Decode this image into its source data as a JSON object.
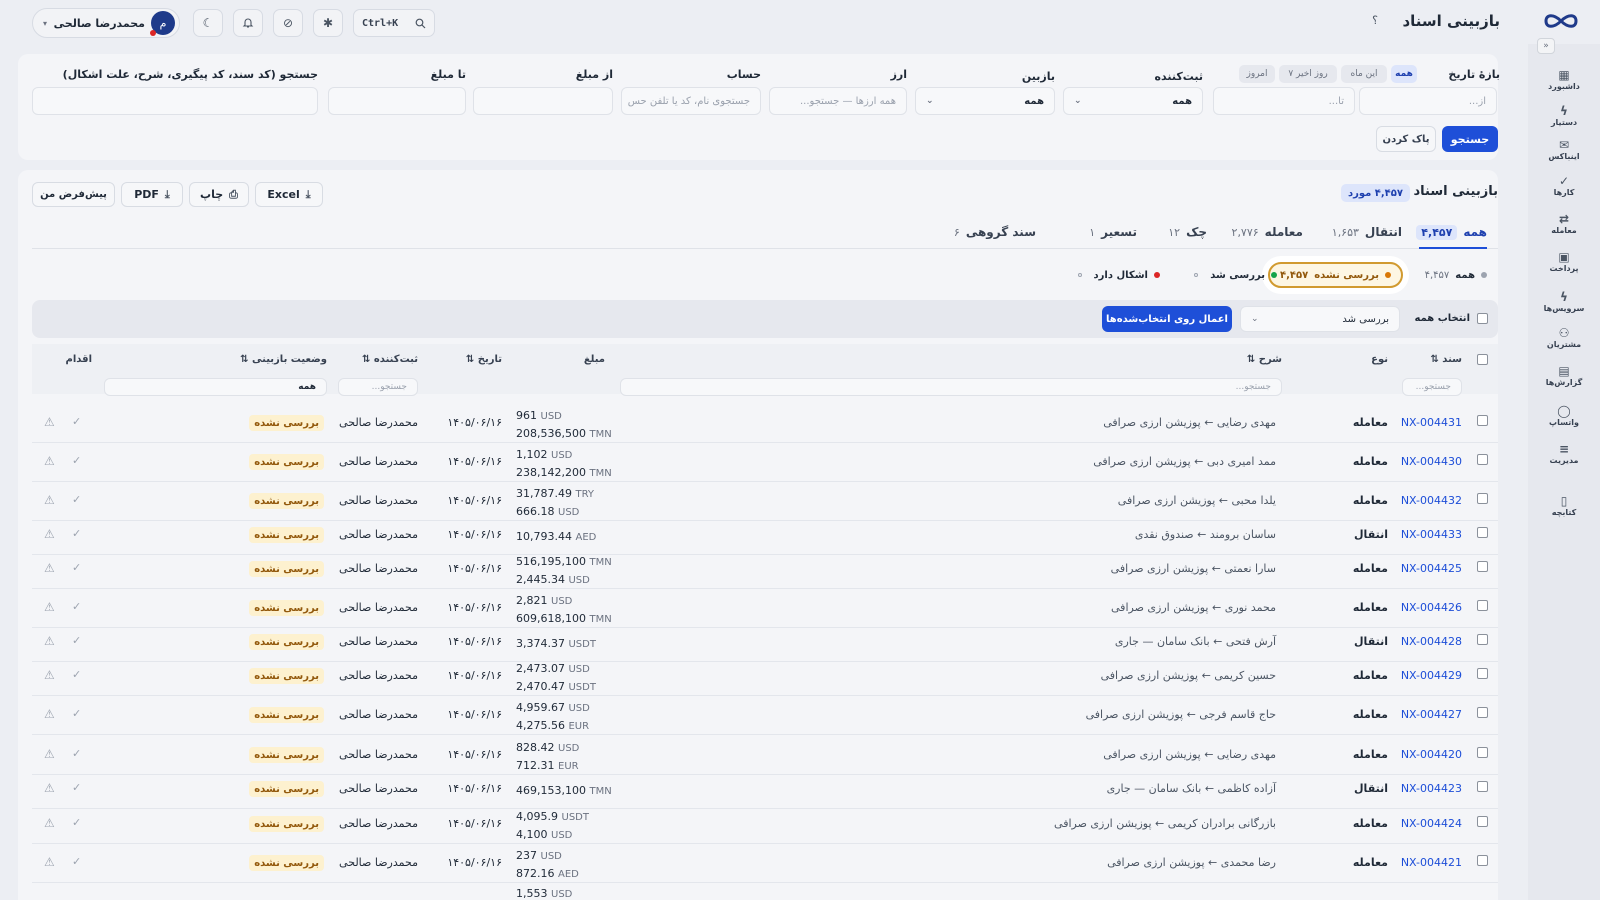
{
  "page_title": "بازبینی اسناد",
  "user": {
    "name": "محمدرضا صالحی",
    "avatar_initial": "م"
  },
  "search_shortcut": "Ctrl+K",
  "sidebar_items": [
    {
      "label": "داشبورد",
      "icon": "dashboard-icon",
      "glyph": "▦"
    },
    {
      "label": "دستیار",
      "icon": "bolt-icon",
      "glyph": "ϟ"
    },
    {
      "label": "اینباکس",
      "icon": "inbox-icon",
      "glyph": "✉"
    },
    {
      "label": "کارها",
      "icon": "check-icon",
      "glyph": "✓"
    },
    {
      "label": "معامله",
      "icon": "exchange-icon",
      "glyph": "⇄"
    },
    {
      "label": "پرداخت",
      "icon": "wallet-icon",
      "glyph": "▣"
    },
    {
      "label": "سرویس‌ها",
      "icon": "bolt-icon",
      "glyph": "ϟ"
    },
    {
      "label": "مشتریان",
      "icon": "users-icon",
      "glyph": "⚇"
    },
    {
      "label": "گزارش‌ها",
      "icon": "report-icon",
      "glyph": "▤"
    },
    {
      "label": "واتساپ",
      "icon": "chat-icon",
      "glyph": "◯"
    },
    {
      "label": "مدیریت",
      "icon": "sliders-icon",
      "glyph": "≡"
    },
    {
      "label": "کتابچه",
      "icon": "book-icon",
      "glyph": "▯"
    }
  ],
  "filters": {
    "date_range_label": "بازهٔ تاریخ",
    "quick_ranges": [
      "همه",
      "این ماه",
      "۷ روز اخیر",
      "امروز"
    ],
    "from_placeholder": "از...",
    "to_placeholder": "تا...",
    "registrar_label": "ثبت‌کننده",
    "registrar_value": "همه",
    "reviewer_label": "بازبین",
    "reviewer_value": "همه",
    "currency_label": "ارز",
    "currency_placeholder": "همه ارزها — جستجو...",
    "account_label": "حساب",
    "account_placeholder": "جستجوی نام، کد یا تلفن حس",
    "amount_from_label": "از مبلغ",
    "amount_to_label": "تا مبلغ",
    "search_label": "جستجو (کد سند، کد پیگیری، شرح، علت اشکال)",
    "search_button": "جستجو",
    "clear_button": "پاک کردن"
  },
  "list": {
    "title": "بازبینی اسناد",
    "count_badge": "۴,۴۵۷ مورد",
    "toolbar": {
      "excel": "Excel",
      "print": "چاپ",
      "pdf": "PDF",
      "default": "پیش‌فرض من"
    },
    "tabs": [
      {
        "label": "همه",
        "count": "۴,۴۵۷"
      },
      {
        "label": "انتقال",
        "count": "۱,۶۵۳"
      },
      {
        "label": "معامله",
        "count": "۲,۷۷۶"
      },
      {
        "label": "چک",
        "count": "۱۲"
      },
      {
        "label": "تسعیر",
        "count": "۱"
      },
      {
        "label": "سند گروهی",
        "count": "۶"
      }
    ],
    "status_filters": [
      {
        "label": "همه",
        "count": "۴,۴۵۷",
        "color": "#9ca3af"
      },
      {
        "label": "بررسی نشده",
        "count": "۴,۴۵۷",
        "color": "#d97706"
      },
      {
        "label": "بررسی شد",
        "count": "",
        "color": "#16a34a"
      },
      {
        "label": "اشکال دارد",
        "count": "",
        "color": "#dc2626"
      }
    ],
    "select_all": "انتخاب همه",
    "bulk_action_value": "بررسی شد",
    "apply_button": "اعمال روی انتخاب‌شده‌ها",
    "columns": {
      "doc": "سند ⇅",
      "type": "نوع",
      "desc": "شرح ⇅",
      "amount": "مبلغ",
      "date": "تاریخ ⇅",
      "registrar": "ثبت‌کننده ⇅",
      "status": "وضعیت بازبینی ⇅",
      "action": "اقدام"
    },
    "column_filters": {
      "doc": "جستجو...",
      "desc": "جستجو...",
      "registrar": "جستجو...",
      "status": "همه"
    }
  },
  "rows": [
    {
      "code": "NX-004431",
      "type": "معامله",
      "desc": "مهدی رضایی ← پوزیشن ارزی صرافی",
      "amounts": [
        {
          "v": "961",
          "c": "USD"
        },
        {
          "v": "208,536,500",
          "c": "TMN"
        }
      ],
      "date": "۱۴۰۵/۰۶/۱۶",
      "registrar": "محمدرضا صالحی",
      "status": "بررسی نشده"
    },
    {
      "code": "NX-004430",
      "type": "معامله",
      "desc": "ممد امیری دبی ← پوزیشن ارزی صرافی",
      "amounts": [
        {
          "v": "1,102",
          "c": "USD"
        },
        {
          "v": "238,142,200",
          "c": "TMN"
        }
      ],
      "date": "۱۴۰۵/۰۶/۱۶",
      "registrar": "محمدرضا صالحی",
      "status": "بررسی نشده"
    },
    {
      "code": "NX-004432",
      "type": "معامله",
      "desc": "یلدا محبی ← پوزیشن ارزی صرافی",
      "amounts": [
        {
          "v": "31,787.49",
          "c": "TRY"
        },
        {
          "v": "666.18",
          "c": "USD"
        }
      ],
      "date": "۱۴۰۵/۰۶/۱۶",
      "registrar": "محمدرضا صالحی",
      "status": "بررسی نشده"
    },
    {
      "code": "NX-004433",
      "type": "انتقال",
      "desc": "ساسان برومند ← صندوق نقدی",
      "amounts": [
        {
          "v": "10,793.44",
          "c": "AED"
        }
      ],
      "date": "۱۴۰۵/۰۶/۱۶",
      "registrar": "محمدرضا صالحی",
      "status": "بررسی نشده"
    },
    {
      "code": "NX-004425",
      "type": "معامله",
      "desc": "سارا نعمتی ← پوزیشن ارزی صرافی",
      "amounts": [
        {
          "v": "516,195,100",
          "c": "TMN"
        },
        {
          "v": "2,445.34",
          "c": "USD"
        }
      ],
      "date": "۱۴۰۵/۰۶/۱۶",
      "registrar": "محمدرضا صالحی",
      "status": "بررسی نشده"
    },
    {
      "code": "NX-004426",
      "type": "معامله",
      "desc": "محمد نوری ← پوزیشن ارزی صرافی",
      "amounts": [
        {
          "v": "2,821",
          "c": "USD"
        },
        {
          "v": "609,618,100",
          "c": "TMN"
        }
      ],
      "date": "۱۴۰۵/۰۶/۱۶",
      "registrar": "محمدرضا صالحی",
      "status": "بررسی نشده"
    },
    {
      "code": "NX-004428",
      "type": "انتقال",
      "desc": "آرش فتحی ← بانک سامان — جاری",
      "amounts": [
        {
          "v": "3,374.37",
          "c": "USDT"
        }
      ],
      "date": "۱۴۰۵/۰۶/۱۶",
      "registrar": "محمدرضا صالحی",
      "status": "بررسی نشده"
    },
    {
      "code": "NX-004429",
      "type": "معامله",
      "desc": "حسین کریمی ← پوزیشن ارزی صرافی",
      "amounts": [
        {
          "v": "2,473.07",
          "c": "USD"
        },
        {
          "v": "2,470.47",
          "c": "USDT"
        }
      ],
      "date": "۱۴۰۵/۰۶/۱۶",
      "registrar": "محمدرضا صالحی",
      "status": "بررسی نشده"
    },
    {
      "code": "NX-004427",
      "type": "معامله",
      "desc": "حاج قاسم فرجی ← پوزیشن ارزی صرافی",
      "amounts": [
        {
          "v": "4,959.67",
          "c": "USD"
        },
        {
          "v": "4,275.56",
          "c": "EUR"
        }
      ],
      "date": "۱۴۰۵/۰۶/۱۶",
      "registrar": "محمدرضا صالحی",
      "status": "بررسی نشده"
    },
    {
      "code": "NX-004420",
      "type": "معامله",
      "desc": "مهدی رضایی ← پوزیشن ارزی صرافی",
      "amounts": [
        {
          "v": "828.42",
          "c": "USD"
        },
        {
          "v": "712.31",
          "c": "EUR"
        }
      ],
      "date": "۱۴۰۵/۰۶/۱۶",
      "registrar": "محمدرضا صالحی",
      "status": "بررسی نشده"
    },
    {
      "code": "NX-004423",
      "type": "انتقال",
      "desc": "آزاده کاظمی ← بانک سامان — جاری",
      "amounts": [
        {
          "v": "469,153,100",
          "c": "TMN"
        }
      ],
      "date": "۱۴۰۵/۰۶/۱۶",
      "registrar": "محمدرضا صالحی",
      "status": "بررسی نشده"
    },
    {
      "code": "NX-004424",
      "type": "معامله",
      "desc": "بازرگانی برادران کریمی ← پوزیشن ارزی صرافی",
      "amounts": [
        {
          "v": "4,095.9",
          "c": "USDT"
        },
        {
          "v": "4,100",
          "c": "USD"
        }
      ],
      "date": "۱۴۰۵/۰۶/۱۶",
      "registrar": "محمدرضا صالحی",
      "status": "بررسی نشده"
    },
    {
      "code": "NX-004421",
      "type": "معامله",
      "desc": "رضا محمدی ← پوزیشن ارزی صرافی",
      "amounts": [
        {
          "v": "237",
          "c": "USD"
        },
        {
          "v": "872.16",
          "c": "AED"
        }
      ],
      "date": "۱۴۰۵/۰۶/۱۶",
      "registrar": "محمدرضا صالحی",
      "status": "بررسی نشده"
    },
    {
      "code": "",
      "type": "",
      "desc": "",
      "amounts": [
        {
          "v": "1,553",
          "c": "USD"
        }
      ],
      "date": "",
      "registrar": "",
      "status": ""
    }
  ],
  "colors": {
    "primary": "#1e4fd8",
    "link": "#1d4ed8",
    "badge_bg": "#fdf1cf",
    "badge_text": "#92580b"
  }
}
